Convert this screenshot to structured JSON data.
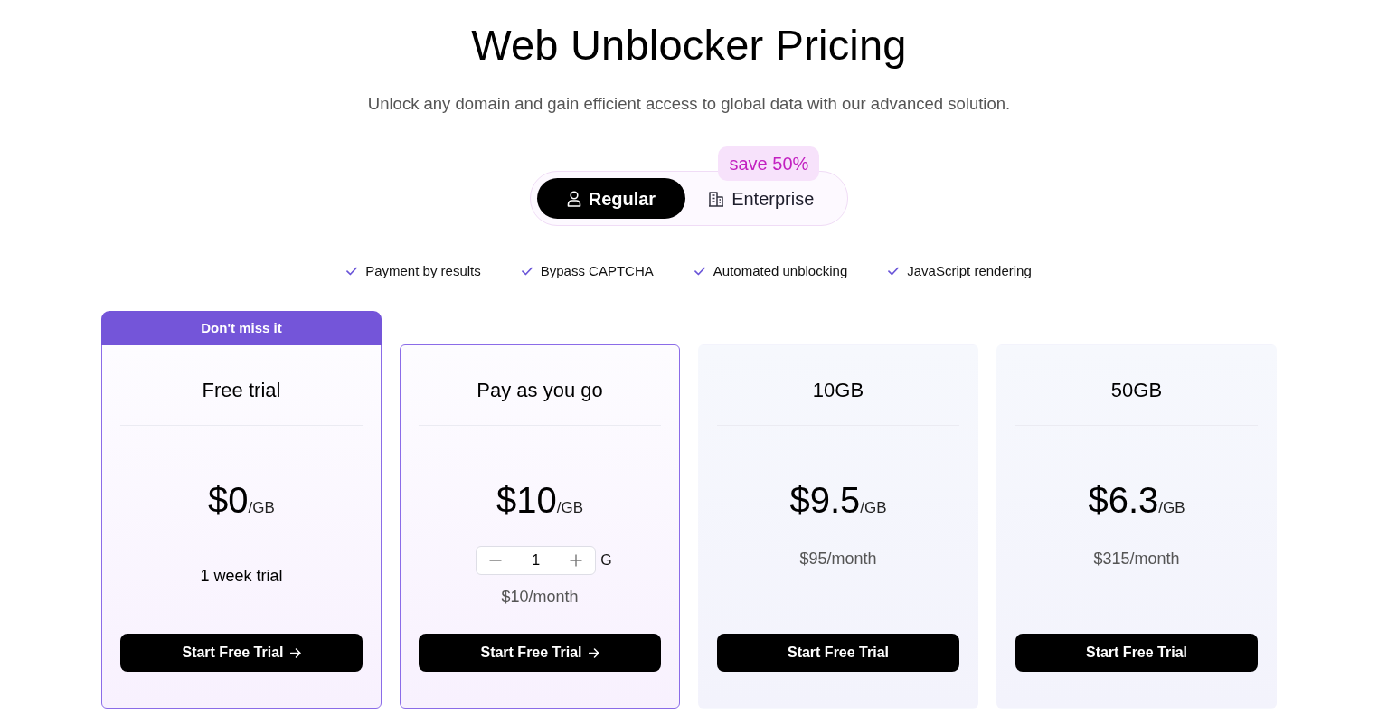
{
  "header": {
    "title": "Web Unblocker Pricing",
    "subtitle": "Unlock any domain and gain efficient access to global data with our advanced solution."
  },
  "plan_switch": {
    "tabs": [
      {
        "label": "Regular",
        "kind": "individual",
        "selected": true
      },
      {
        "label": "Enterprise",
        "kind": "business",
        "selected": false
      }
    ],
    "badge": "save 50%"
  },
  "features": [
    "Payment by results",
    "Bypass CAPTCHA",
    "Automated unblocking",
    "JavaScript rendering"
  ],
  "plans": [
    {
      "ribbon": "Don't miss it",
      "name": "Free trial",
      "highlighted": true,
      "price": "$0",
      "unit": "/GB",
      "note": "1 week trial",
      "button": {
        "label": "Start Free Trial",
        "arrow": true
      }
    },
    {
      "name": "Pay as you go",
      "highlighted": true,
      "price": "$10",
      "unit": "/GB",
      "quantity": {
        "value": "1",
        "unit": "G"
      },
      "monthly": "$10/month",
      "button": {
        "label": "Start Free Trial",
        "arrow": true
      }
    },
    {
      "name": "10GB",
      "highlighted": false,
      "price": "$9.5",
      "unit": "/GB",
      "monthly": "$95/month",
      "button": {
        "label": "Start Free Trial",
        "arrow": false
      }
    },
    {
      "name": "50GB",
      "highlighted": false,
      "price": "$6.3",
      "unit": "/GB",
      "monthly": "$315/month",
      "button": {
        "label": "Start Free Trial",
        "arrow": false
      }
    }
  ]
}
